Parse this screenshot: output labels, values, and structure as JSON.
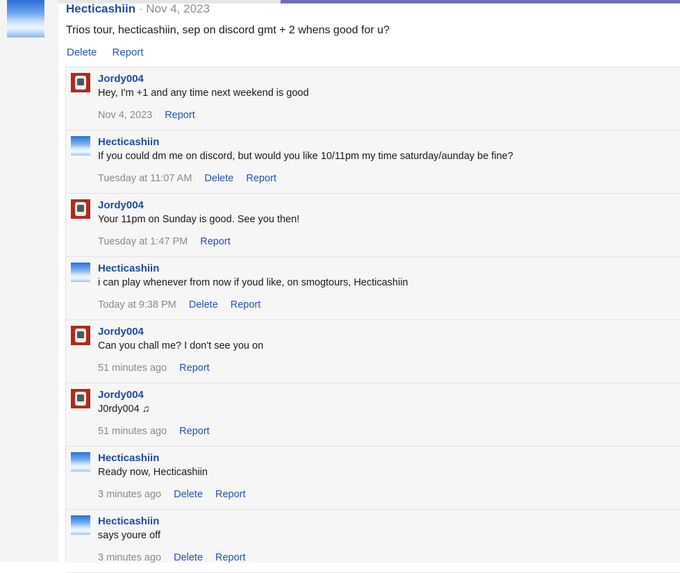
{
  "post": {
    "author": "Hecticashiin",
    "separator": "·",
    "date": "Nov 4, 2023",
    "text": "Trios tour, hecticashiin, sep on discord gmt + 2 whens good for u?",
    "actions": {
      "delete": "Delete",
      "report": "Report"
    }
  },
  "comments": [
    {
      "author": "Jordy004",
      "avatar": "red-robot-avatar",
      "text": "Hey, I'm +1 and any time next weekend is good",
      "time": "Nov 4, 2023",
      "delete": "",
      "report": "Report"
    },
    {
      "author": "Hecticashiin",
      "avatar": "sky-avatar",
      "text": "If you could dm me on discord, but would you like 10/11pm my time saturday/aunday be fine?",
      "time": "Tuesday at 11:07 AM",
      "delete": "Delete",
      "report": "Report"
    },
    {
      "author": "Jordy004",
      "avatar": "red-robot-avatar",
      "text": "Your 11pm on Sunday is good. See you then!",
      "time": "Tuesday at 1:47 PM",
      "delete": "",
      "report": "Report"
    },
    {
      "author": "Hecticashiin",
      "avatar": "sky-avatar",
      "text": "i can play whenever from now if youd like, on smogtours, Hecticashiin",
      "time": "Today at 9:38 PM",
      "delete": "Delete",
      "report": "Report"
    },
    {
      "author": "Jordy004",
      "avatar": "red-robot-avatar",
      "text": "Can you chall me? I don't see you on",
      "time": "51 minutes ago",
      "delete": "",
      "report": "Report"
    },
    {
      "author": "Jordy004",
      "avatar": "red-robot-avatar",
      "text": "J0rdy004 ♫",
      "time": "51 minutes ago",
      "delete": "",
      "report": "Report"
    },
    {
      "author": "Hecticashiin",
      "avatar": "sky-avatar",
      "text": "Ready now, Hecticashiin",
      "time": "3 minutes ago",
      "delete": "Delete",
      "report": "Report"
    },
    {
      "author": "Hecticashiin",
      "avatar": "sky-avatar",
      "text": "says youre off",
      "time": "3 minutes ago",
      "delete": "Delete",
      "report": "Report"
    }
  ]
}
